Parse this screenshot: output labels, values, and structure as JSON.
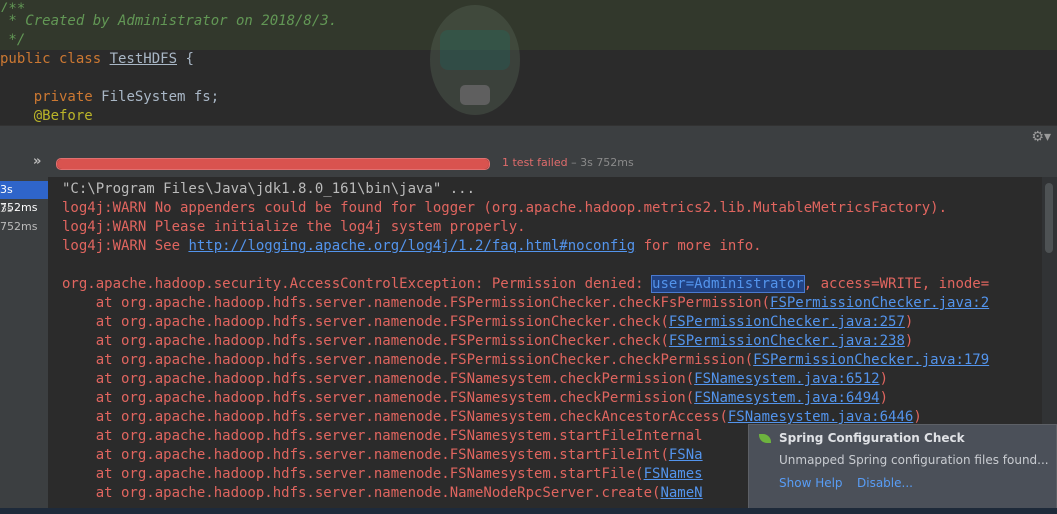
{
  "editor": {
    "lines": [
      {
        "text": "/**",
        "kind": "comment"
      },
      {
        "text": " * Created by Administrator on 2018/8/3.",
        "kind": "comment"
      },
      {
        "text": " */",
        "kind": "comment"
      },
      {
        "keyword": "public class ",
        "classname": "TestHDFS",
        "rest": " {"
      },
      {
        "text": ""
      },
      {
        "keyword": "    private ",
        "rest": "FileSystem fs;"
      },
      {
        "annotation": "    @Before"
      }
    ]
  },
  "toolbar": {
    "settings_icon": "gear-icon",
    "expand_icon": "double-chevron-icon"
  },
  "test_status": {
    "progress_percent": 100,
    "progress_color": "#d9534f",
    "failed_text": "1 test failed",
    "duration_text": " – 3s 752ms"
  },
  "test_tree": {
    "items": [
      {
        "label": "3s 752ms",
        "selected": true
      },
      {
        "label": "3s 752ms",
        "selected": false
      }
    ]
  },
  "console": {
    "cmd_line": "\"C:\\Program Files\\Java\\jdk1.8.0_161\\bin\\java\" ...",
    "warn1": "log4j:WARN No appenders could be found for logger (org.apache.hadoop.metrics2.lib.MutableMetricsFactory).",
    "warn2": "log4j:WARN Please initialize the log4j system properly.",
    "warn3_prefix": "log4j:WARN See ",
    "warn3_link": "http://logging.apache.org/log4j/1.2/faq.html#noconfig",
    "warn3_suffix": " for more info.",
    "exception_prefix": "org.apache.hadoop.security.AccessControlException: Permission denied: ",
    "exception_selected": "user=Administrator",
    "exception_suffix": ", access=WRITE, inode=",
    "stack": [
      {
        "method": "    at org.apache.hadoop.hdfs.server.namenode.FSPermissionChecker.checkFsPermission(",
        "link": "FSPermissionChecker.java:2",
        "end": ""
      },
      {
        "method": "    at org.apache.hadoop.hdfs.server.namenode.FSPermissionChecker.check(",
        "link": "FSPermissionChecker.java:257",
        "end": ")"
      },
      {
        "method": "    at org.apache.hadoop.hdfs.server.namenode.FSPermissionChecker.check(",
        "link": "FSPermissionChecker.java:238",
        "end": ")"
      },
      {
        "method": "    at org.apache.hadoop.hdfs.server.namenode.FSPermissionChecker.checkPermission(",
        "link": "FSPermissionChecker.java:179",
        "end": ""
      },
      {
        "method": "    at org.apache.hadoop.hdfs.server.namenode.FSNamesystem.checkPermission(",
        "link": "FSNamesystem.java:6512",
        "end": ")"
      },
      {
        "method": "    at org.apache.hadoop.hdfs.server.namenode.FSNamesystem.checkPermission(",
        "link": "FSNamesystem.java:6494",
        "end": ")"
      },
      {
        "method": "    at org.apache.hadoop.hdfs.server.namenode.FSNamesystem.checkAncestorAccess(",
        "link": "FSNamesystem.java:6446",
        "end": ")"
      },
      {
        "method": "    at org.apache.hadoop.hdfs.server.namenode.FSNamesystem.startFileInternal",
        "link": "",
        "end": ""
      },
      {
        "method": "    at org.apache.hadoop.hdfs.server.namenode.FSNamesystem.startFileInt(",
        "link": "FSNa",
        "end": ""
      },
      {
        "method": "    at org.apache.hadoop.hdfs.server.namenode.FSNamesystem.startFile(",
        "link": "FSNames",
        "end": ""
      },
      {
        "method": "    at org.apache.hadoop.hdfs.server.namenode.NameNodeRpcServer.create(",
        "link": "NameN",
        "end": ""
      }
    ]
  },
  "notification": {
    "icon": "spring-leaf-icon",
    "title": "Spring Configuration Check",
    "body": "Unmapped Spring configuration files found...",
    "show_help": "Show Help",
    "disable": "Disable..."
  },
  "colors": {
    "error_text": "#e0655f",
    "link": "#5394ec",
    "selection": "#2f65ca"
  }
}
